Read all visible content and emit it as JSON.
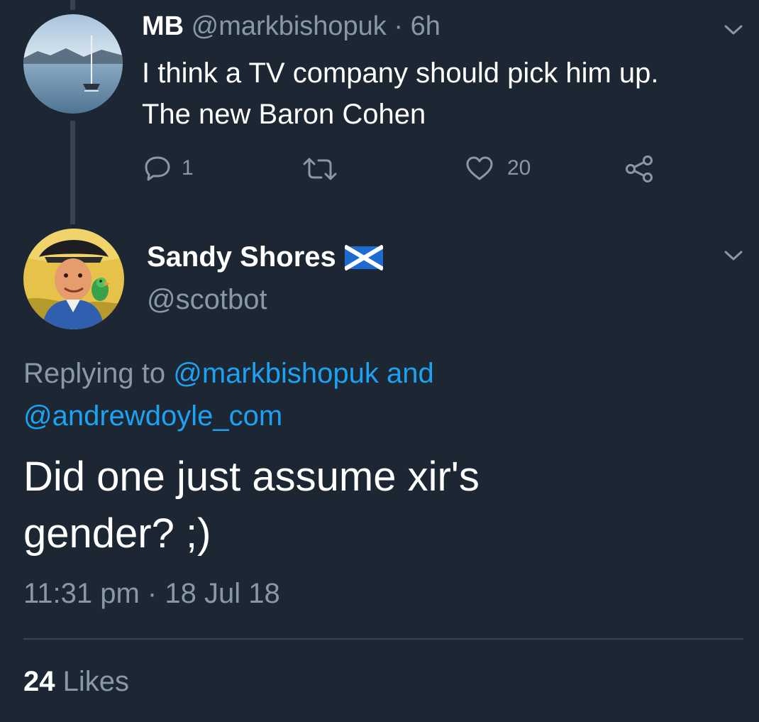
{
  "parent_tweet": {
    "name": "MB",
    "handle": "@markbishopuk",
    "separator": "·",
    "time": "6h",
    "text_line1": "I think a TV company should pick him up.",
    "text_line2": "The new Baron Cohen",
    "reply_count": "1",
    "retweet_count": "",
    "like_count": "20"
  },
  "main_tweet": {
    "name": "Sandy Shores",
    "flag_icon": "scotland-flag-icon",
    "handle": "@scotbot",
    "replying_prefix": "Replying to",
    "replying_user1": "@markbishopuk",
    "replying_and": "and",
    "replying_user2": "@andrewdoyle_com",
    "text_line1": "Did one just assume xir's",
    "text_line2": "gender? ;)",
    "timestamp": "11:31 pm · 18 Jul 18",
    "likes_count": "24",
    "likes_label": "Likes"
  },
  "colors": {
    "background": "#1c2733",
    "text": "#ffffff",
    "muted": "#8899a6",
    "link": "#1da1f2",
    "divider": "#38444d"
  }
}
